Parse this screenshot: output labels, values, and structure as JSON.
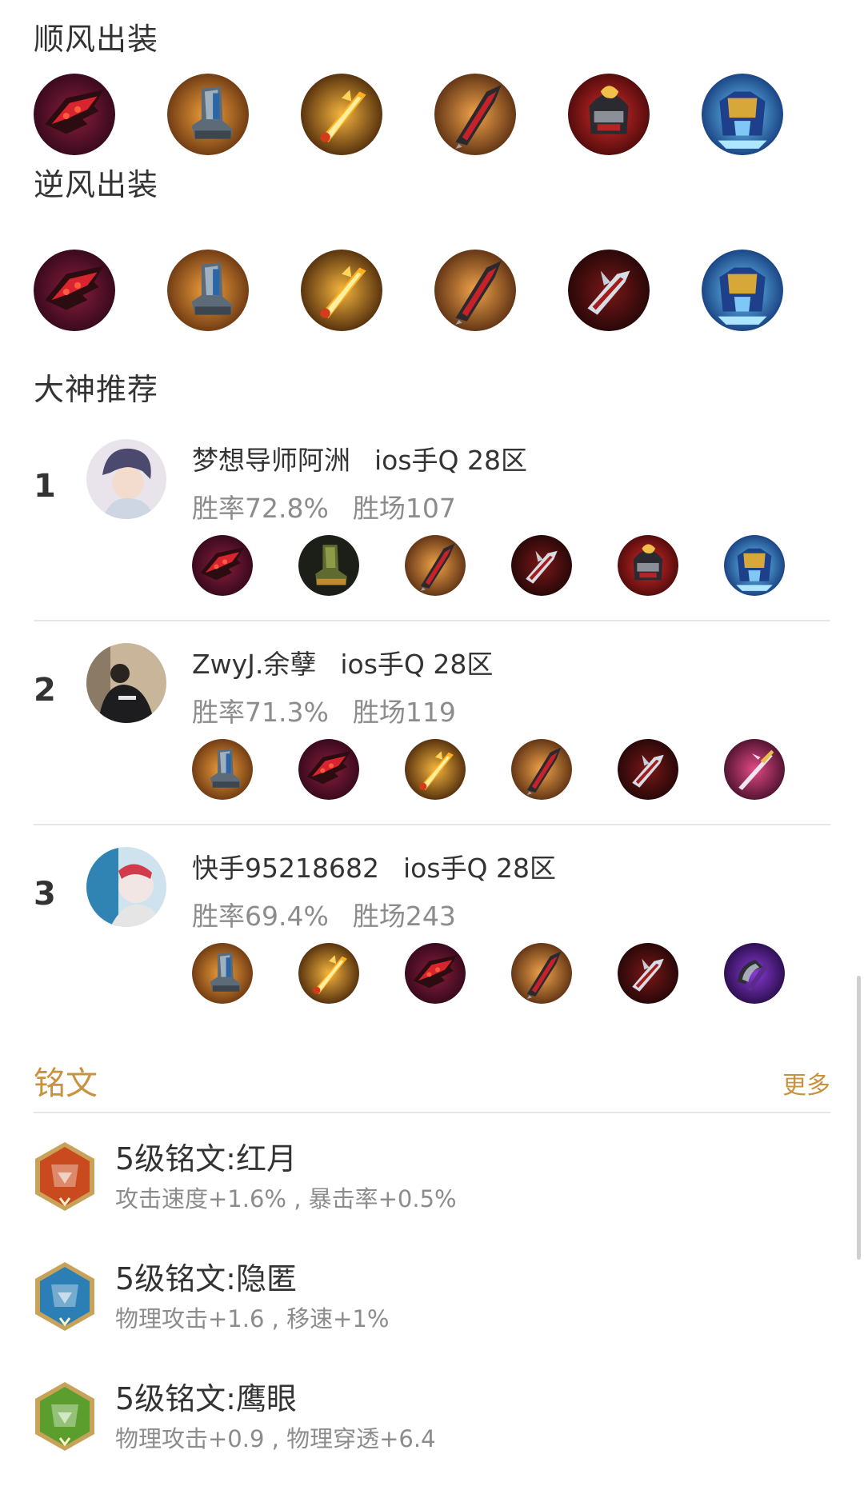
{
  "shunfeng": {
    "title": "顺风出装",
    "items": [
      "dusk-claw-icon",
      "boots-icon",
      "fire-blade-icon",
      "demon-blade-icon",
      "helm-icon",
      "armor-icon"
    ]
  },
  "nifeng": {
    "title": "逆风出装",
    "items": [
      "dusk-claw-icon",
      "boots-icon",
      "fire-blade-icon",
      "demon-blade-icon",
      "dark-blade-icon",
      "armor-icon"
    ]
  },
  "recommend": {
    "title": "大神推荐",
    "players": [
      {
        "rank": "1",
        "name": "梦想导师阿洲",
        "server": "ios手Q 28区",
        "winrate": "胜率72.8%",
        "wins": "胜场107",
        "items": [
          "dusk-claw-icon",
          "green-boots-icon",
          "demon-blade-icon",
          "dark-blade-icon",
          "helm-icon",
          "armor-icon"
        ]
      },
      {
        "rank": "2",
        "name": "ZwyJ.余孽",
        "server": "ios手Q 28区",
        "winrate": "胜率71.3%",
        "wins": "胜场119",
        "items": [
          "boots-icon",
          "dusk-claw-icon",
          "fire-blade-icon",
          "demon-blade-icon",
          "dark-blade-icon",
          "pink-spear-icon"
        ]
      },
      {
        "rank": "3",
        "name": "快手95218682",
        "server": "ios手Q 28区",
        "winrate": "胜率69.4%",
        "wins": "胜场243",
        "items": [
          "boots-icon",
          "fire-blade-icon",
          "dusk-claw-icon",
          "demon-blade-icon",
          "dark-blade-icon",
          "purple-axe-icon"
        ]
      }
    ]
  },
  "inscriptions": {
    "title": "铭文",
    "more": "更多",
    "items": [
      {
        "name": "5级铭文:红月",
        "desc": "攻击速度+1.6% , 暴击率+0.5%",
        "color": "#c94a1e",
        "icon": "red-moon-icon"
      },
      {
        "name": "5级铭文:隐匿",
        "desc": "物理攻击+1.6 , 移速+1%",
        "color": "#2b7fb5",
        "icon": "hidden-icon"
      },
      {
        "name": "5级铭文:鹰眼",
        "desc": "物理攻击+0.9 , 物理穿透+6.4",
        "color": "#5c9e2e",
        "icon": "hawk-eye-icon"
      }
    ]
  }
}
